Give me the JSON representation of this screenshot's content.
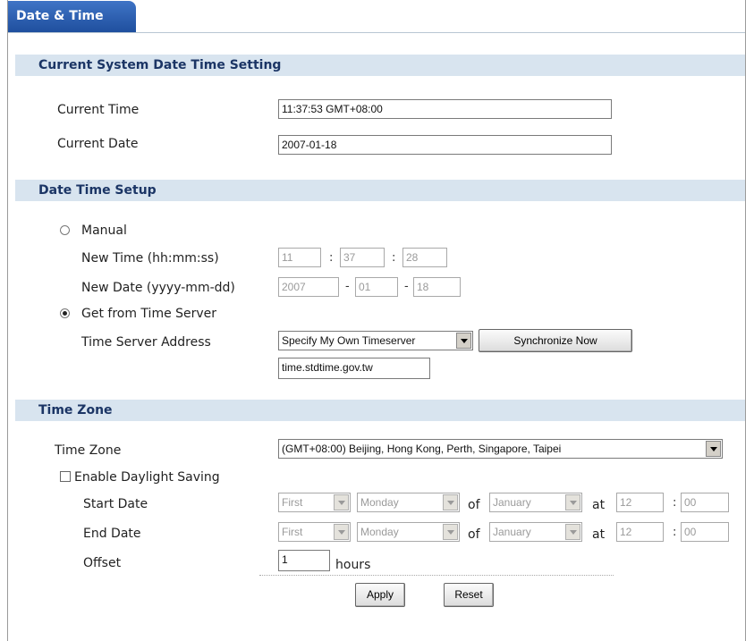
{
  "tab": {
    "label": "Date & Time"
  },
  "current": {
    "section_title": "Current System Date Time Setting",
    "time_label": "Current Time",
    "time_value": "11:37:53 GMT+08:00",
    "date_label": "Current Date",
    "date_value": "2007-01-18"
  },
  "setup": {
    "section_title": "Date Time Setup",
    "manual_label": "Manual",
    "new_time_label": "New Time (hh:mm:ss)",
    "time_hh": "11",
    "time_mm": "37",
    "time_ss": "28",
    "time_sep": ":",
    "new_date_label": "New Date (yyyy-mm-dd)",
    "date_yyyy": "2007",
    "date_mm": "01",
    "date_dd": "18",
    "date_sep": "-",
    "server_radio_label": "Get from Time Server",
    "server_address_label": "Time Server Address",
    "server_select_value": "Specify My Own Timeserver",
    "sync_button": "Synchronize Now",
    "server_host": "time.stdtime.gov.tw"
  },
  "timezone": {
    "section_title": "Time Zone",
    "zone_label": "Time Zone",
    "zone_value": "(GMT+08:00) Beijing, Hong Kong, Perth, Singapore, Taipei",
    "dst_label": "Enable Daylight Saving",
    "start_label": "Start Date",
    "end_label": "End Date",
    "offset_label": "Offset",
    "week_value": "First",
    "day_value": "Monday",
    "of_text": "of",
    "month_value": "January",
    "at_text": "at",
    "hour_value": "12",
    "colon": ":",
    "minute_value": "00",
    "offset_value": "1",
    "hours_text": "hours"
  },
  "actions": {
    "apply": "Apply",
    "reset": "Reset"
  }
}
